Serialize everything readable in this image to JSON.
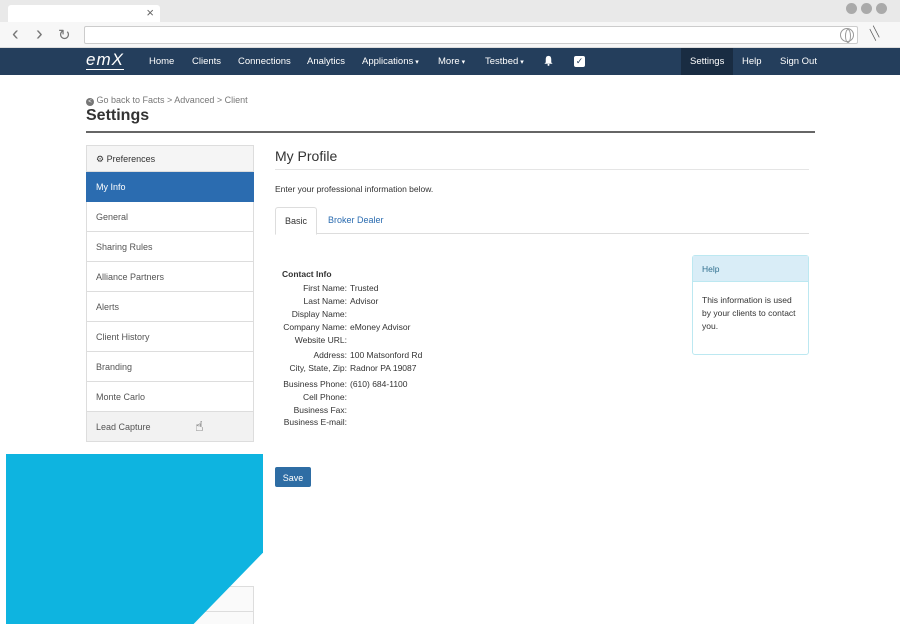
{
  "browser": {
    "tab_close": "×",
    "back_icon": "‹",
    "forward_icon": "›",
    "reload_icon": "↻",
    "url": ""
  },
  "navbar": {
    "logo": "emX",
    "items": [
      {
        "label": "Home"
      },
      {
        "label": "Clients"
      },
      {
        "label": "Connections"
      },
      {
        "label": "Analytics"
      },
      {
        "label": "Applications"
      },
      {
        "label": "More"
      },
      {
        "label": "Testbed"
      }
    ],
    "right_items": [
      {
        "label": "Settings"
      },
      {
        "label": "Help"
      },
      {
        "label": "Sign Out"
      }
    ],
    "caret": "▾",
    "check_glyph": "✓",
    "bg_color": "#243e5c"
  },
  "page": {
    "breadcrumb": "Go back to Facts > Advanced > Client",
    "title": "Settings"
  },
  "sidebar": {
    "header": "Preferences",
    "items": [
      {
        "label": "My Info"
      },
      {
        "label": "General"
      },
      {
        "label": "Sharing Rules"
      },
      {
        "label": "Alliance Partners"
      },
      {
        "label": "Alerts"
      },
      {
        "label": "Client History"
      },
      {
        "label": "Branding"
      },
      {
        "label": "Monte Carlo"
      },
      {
        "label": "Lead Capture"
      }
    ],
    "active_color": "#2b6cb0"
  },
  "main": {
    "title": "My Profile",
    "intro": "Enter your professional information below.",
    "tabs": [
      {
        "label": "Basic"
      },
      {
        "label": "Broker Dealer"
      }
    ],
    "contact_heading": "Contact Info",
    "fields": [
      {
        "label": "First Name:",
        "value": "Trusted"
      },
      {
        "label": "Last Name:",
        "value": "Advisor"
      },
      {
        "label": "Display Name:",
        "value": ""
      },
      {
        "label": "Company Name:",
        "value": "eMoney Advisor"
      },
      {
        "label": "Website URL:",
        "value": ""
      },
      {
        "label": "Address:",
        "value": "100 Matsonford Rd"
      },
      {
        "label": "City, State, Zip:",
        "value": "Radnor PA 19087"
      },
      {
        "label": "Business Phone:",
        "value": "(610) 684-1100"
      },
      {
        "label": "Cell Phone:",
        "value": ""
      },
      {
        "label": "Business Fax:",
        "value": ""
      },
      {
        "label": "Business E-mail:",
        "value": ""
      }
    ],
    "save_label": "Save"
  },
  "help": {
    "title": "Help",
    "body": "This information is used by your clients to contact you."
  },
  "overlay_color": "#0eb4e0"
}
